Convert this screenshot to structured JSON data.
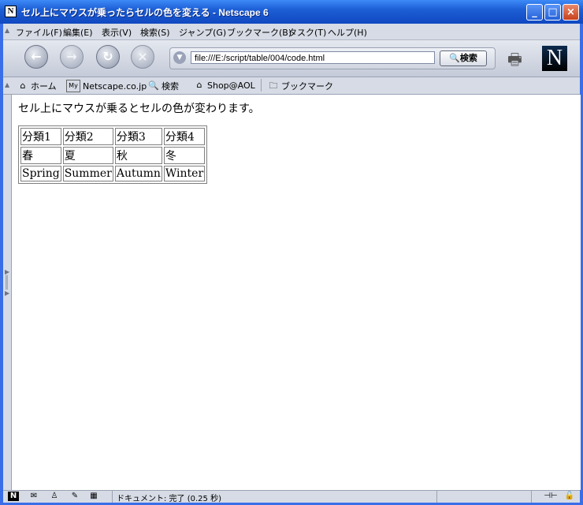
{
  "window": {
    "title": "セル上にマウスが乗ったらセルの色を変える - Netscape 6",
    "app_icon": "N",
    "controls": {
      "minimize": "_",
      "maximize": "□",
      "close": "×"
    }
  },
  "menubar": {
    "items": [
      {
        "label": "ファイル(F)"
      },
      {
        "label": "編集(E)"
      },
      {
        "label": "表示(V)"
      },
      {
        "label": "検索(S)"
      },
      {
        "label": "ジャンプ(G)"
      },
      {
        "label": "ブックマーク(B)"
      },
      {
        "label": "タスク(T)"
      },
      {
        "label": "ヘルプ(H)"
      }
    ]
  },
  "navbar": {
    "back_icon": "back-arrow",
    "forward_icon": "forward-arrow",
    "reload_icon": "reload",
    "stop_icon": "stop",
    "url": "file:///E:/script/table/004/code.html",
    "search_button": "検索",
    "logo": "N"
  },
  "personal_toolbar": {
    "items": [
      {
        "label": "ホーム",
        "icon": "home-icon"
      },
      {
        "label": "Netscape.co.jp",
        "icon": "my-netscape-icon",
        "badge": "My"
      },
      {
        "label": "検索",
        "icon": "search-icon"
      },
      {
        "label": "Shop@AOL",
        "icon": "shop-icon"
      },
      {
        "label": "ブックマーク",
        "icon": "folder-icon"
      }
    ]
  },
  "page": {
    "heading": "セル上にマウスが乗るとセルの色が変わります。",
    "table": {
      "rows": [
        [
          "分類1",
          "分類2",
          "分類3",
          "分類4"
        ],
        [
          "春",
          "夏",
          "秋",
          "冬"
        ],
        [
          "Spring",
          "Summer",
          "Autumn",
          "Winter"
        ]
      ]
    }
  },
  "statusbar": {
    "text": "ドキュメント: 完了 (0.25 秒)"
  }
}
